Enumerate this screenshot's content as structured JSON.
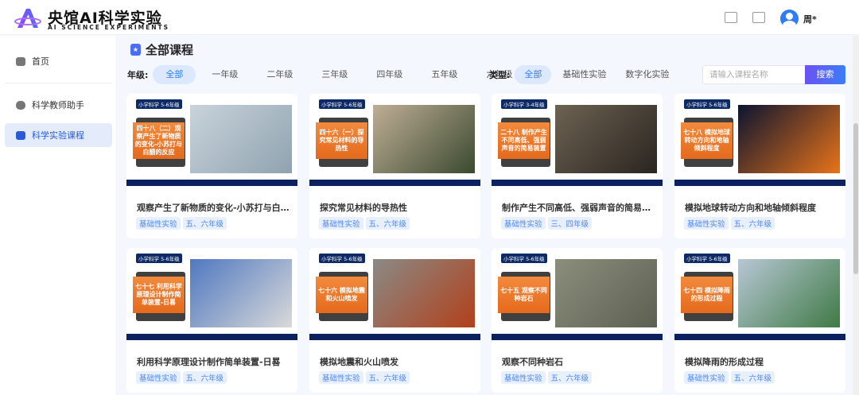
{
  "header": {
    "brand": "央馆AI科学实验",
    "brand_sub": "AI SCIENCE EXPERIMENTS",
    "user": "周*"
  },
  "sidebar": {
    "items": [
      {
        "label": "首页"
      },
      {
        "label": "科学教师助手"
      },
      {
        "label": "科学实验课程"
      }
    ]
  },
  "main": {
    "title": "全部课程",
    "grade_label": "年级:",
    "grades": [
      "全部",
      "一年级",
      "二年级",
      "三年级",
      "四年级",
      "五年级",
      "六年级"
    ],
    "type_label": "类型:",
    "types": [
      "全部",
      "基础性实验",
      "数字化实验"
    ],
    "search_placeholder": "请输入课程名称",
    "search_button": "搜索",
    "courses": [
      {
        "badge": "小学科学 5-6年级",
        "label": "四十八（二）观察产生了新物质的变化-小苏打与白醋的反应",
        "title": "观察产生了新物质的变化-小苏打与白醋的反应",
        "tags": [
          "基础性实验",
          "五、六年级"
        ],
        "colors": [
          "#c9d3db",
          "#8fa3b0"
        ]
      },
      {
        "badge": "小学科学 5-6年级",
        "label": "四十六（一）探究常见材料的导热性",
        "title": "探究常见材料的导热性",
        "tags": [
          "基础性实验",
          "五、六年级"
        ],
        "colors": [
          "#bfae96",
          "#3b4a30"
        ]
      },
      {
        "badge": "小学科学 3-4年级",
        "label": "二十八 制作产生不同高低、强弱声音的简易装置",
        "title": "制作产生不同高低、强弱声音的简易装置",
        "tags": [
          "基础性实验",
          "三、四年级"
        ],
        "colors": [
          "#6d6252",
          "#2a2520"
        ]
      },
      {
        "badge": "小学科学 5-6年级",
        "label": "七十八 模拟地球转动方向和地轴倾斜程度",
        "title": "模拟地球转动方向和地轴倾斜程度",
        "tags": [
          "基础性实验",
          "五、六年级"
        ],
        "colors": [
          "#0c1430",
          "#e8731a"
        ]
      },
      {
        "badge": "小学科学 5-6年级",
        "label": "七十七 利用科学原理设计制作简单装置-日晷",
        "title": "利用科学原理设计制作简单装置-日晷",
        "tags": [
          "基础性实验",
          "五、六年级"
        ],
        "colors": [
          "#4f78c0",
          "#d9d9d9"
        ]
      },
      {
        "badge": "小学科学 5-6年级",
        "label": "七十六 模拟地震和火山喷发",
        "title": "模拟地震和火山喷发",
        "tags": [
          "基础性实验",
          "五、六年级"
        ],
        "colors": [
          "#8a8a86",
          "#b2401a"
        ]
      },
      {
        "badge": "小学科学 5-6年级",
        "label": "七十五 观察不同种岩石",
        "title": "观察不同种岩石",
        "tags": [
          "基础性实验",
          "五、六年级"
        ],
        "colors": [
          "#8c8e7c",
          "#5d5f52"
        ]
      },
      {
        "badge": "小学科学 5-6年级",
        "label": "七十四 模拟降雨的形成过程",
        "title": "模拟降雨的形成过程",
        "tags": [
          "基础性实验",
          "五、六年级"
        ],
        "colors": [
          "#b7c7d4",
          "#3f7a46"
        ]
      }
    ]
  }
}
